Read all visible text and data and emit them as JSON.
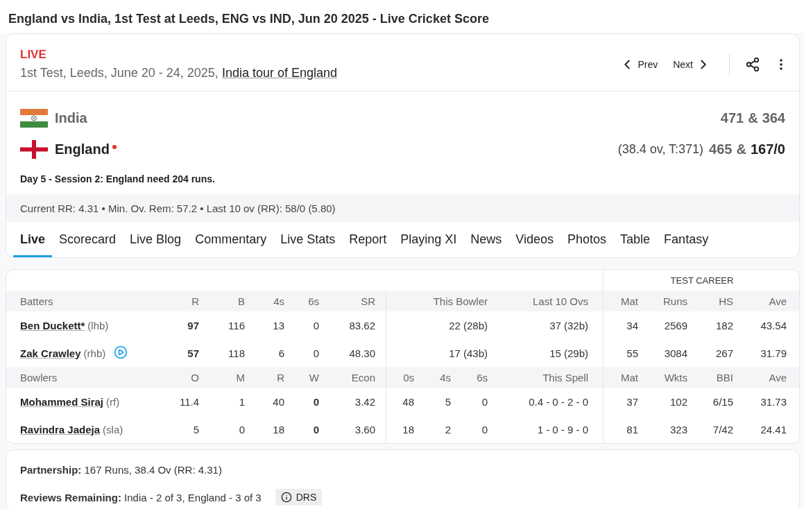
{
  "page_title": "England vs India, 1st Test at Leeds, ENG vs IND, Jun 20 2025 - Live Cricket Score",
  "match": {
    "status": "LIVE",
    "description": "1st Test, Leeds, June 20 - 24, 2025,",
    "series_link": "India tour of England",
    "prev": "Prev",
    "next": "Next"
  },
  "teams": [
    {
      "name": "India",
      "kind": "india",
      "batting": false,
      "innings": [
        {
          "score": "471",
          "current": false
        },
        {
          "score": "364",
          "current": false
        }
      ],
      "separator": "&"
    },
    {
      "name": "England",
      "kind": "england",
      "batting": true,
      "detail": "(38.4 ov, T:371)",
      "innings": [
        {
          "score": "465",
          "current": false
        },
        {
          "score": "167/0",
          "current": true
        }
      ],
      "separator": "&"
    }
  ],
  "status_text": "Day 5 - Session 2: England need 204 runs.",
  "rates": "Current RR: 4.31 • Min. Ov. Rem: 57.2 • Last 10 ov (RR): 58/0 (5.80)",
  "tabs": [
    {
      "label": "Live",
      "selected": true
    },
    {
      "label": "Scorecard",
      "selected": false
    },
    {
      "label": "Live Blog",
      "selected": false
    },
    {
      "label": "Commentary",
      "selected": false
    },
    {
      "label": "Live Stats",
      "selected": false
    },
    {
      "label": "Report",
      "selected": false
    },
    {
      "label": "Playing XI",
      "selected": false
    },
    {
      "label": "News",
      "selected": false
    },
    {
      "label": "Videos",
      "selected": false
    },
    {
      "label": "Photos",
      "selected": false
    },
    {
      "label": "Table",
      "selected": false
    },
    {
      "label": "Fantasy",
      "selected": false
    }
  ],
  "scorecard": {
    "career_heading": "TEST CAREER",
    "sections": [
      {
        "kind": "batting",
        "name_column": "Batters",
        "columns": [
          "R",
          "B",
          "4s",
          "6s",
          "SR",
          "This Bowler",
          "Last 10 Ovs",
          "Mat",
          "Runs",
          "HS",
          "Ave"
        ],
        "rows": [
          {
            "name": "Ben Duckett*",
            "style": "(lhb)",
            "video": false,
            "cells": [
              "97",
              "116",
              "13",
              "0",
              "83.62",
              "22 (28b)",
              "37 (32b)",
              "34",
              "2569",
              "182",
              "43.54"
            ]
          },
          {
            "name": "Zak Crawley",
            "style": "(rhb)",
            "video": true,
            "cells": [
              "57",
              "118",
              "6",
              "0",
              "48.30",
              "17 (43b)",
              "15 (29b)",
              "55",
              "3084",
              "267",
              "31.79"
            ]
          }
        ]
      },
      {
        "kind": "bowling",
        "name_column": "Bowlers",
        "columns": [
          "O",
          "M",
          "R",
          "W",
          "Econ",
          "0s",
          "4s",
          "6s",
          "This Spell",
          "Mat",
          "Wkts",
          "BBI",
          "Ave"
        ],
        "rows": [
          {
            "name": "Mohammed Siraj",
            "style": "(rf)",
            "video": false,
            "cells": [
              "11.4",
              "1",
              "40",
              "0",
              "3.42",
              "48",
              "5",
              "0",
              "0.4 - 0 - 2 - 0",
              "37",
              "102",
              "6/15",
              "31.73"
            ]
          },
          {
            "name": "Ravindra Jadeja",
            "style": "(sla)",
            "video": false,
            "cells": [
              "5",
              "0",
              "18",
              "0",
              "3.60",
              "18",
              "2",
              "0",
              "1 - 0 - 9 - 0",
              "81",
              "323",
              "7/42",
              "24.41"
            ]
          }
        ]
      }
    ]
  },
  "footer": {
    "partnership_label": "Partnership:",
    "partnership": "167 Runs, 38.4 Ov (RR: 4.31)",
    "reviews_label": "Reviews Remaining:",
    "reviews": "India - 2 of 3, England - 3 of 3",
    "drs": "DRS"
  }
}
